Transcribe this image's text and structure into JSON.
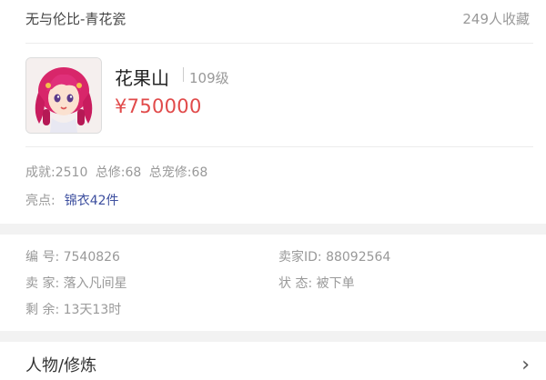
{
  "header": {
    "title": "无与伦比-青花瓷",
    "favorites": "249人收藏"
  },
  "character": {
    "name": "花果山",
    "level": "109级",
    "price": "¥750000"
  },
  "stats": {
    "achievement": "成就:2510",
    "total_cultivation": "总修:68",
    "total_pet_cultivation": "总宠修:68"
  },
  "highlight": {
    "label": "亮点:",
    "value": "锦衣42件"
  },
  "info": {
    "serial": "编 号: 7540826",
    "seller_id": "卖家ID: 88092564",
    "seller": "卖 家: 落入凡间星",
    "status": "状 态: 被下单",
    "remaining": "剩 余: 13天13时"
  },
  "section": {
    "title": "人物/修炼"
  }
}
